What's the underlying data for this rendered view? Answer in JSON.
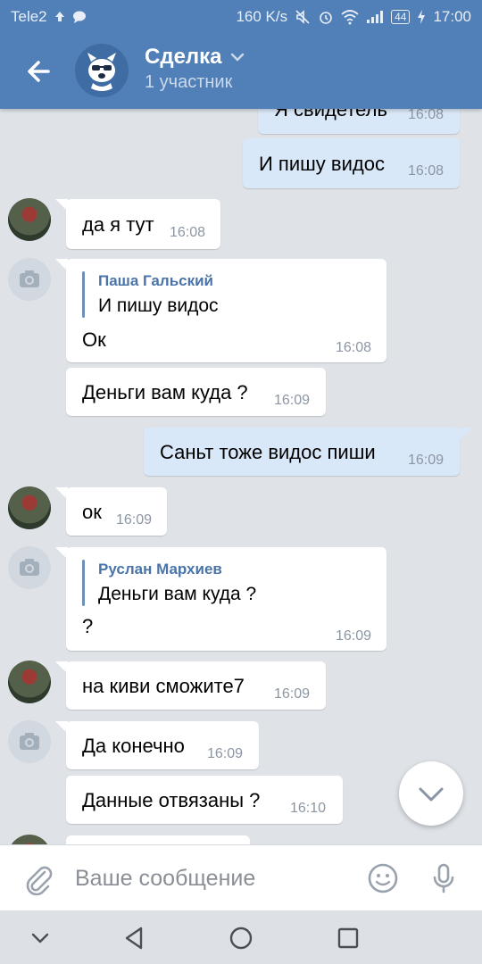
{
  "status_bar": {
    "carrier": "Tele2",
    "speed": "160 K/s",
    "battery": "44",
    "time": "17:00"
  },
  "header": {
    "title": "Сделка",
    "subtitle": "1 участник"
  },
  "messages": [
    {
      "direction": "out",
      "text": "Я свидетель",
      "time": "16:08"
    },
    {
      "direction": "out",
      "text": "И пишу видос",
      "time": "16:08"
    },
    {
      "direction": "in",
      "avatar": "user-photo",
      "text": "да я тут",
      "time": "16:08"
    },
    {
      "direction": "in",
      "avatar": "camera-placeholder",
      "quote_author": "Паша Гальский",
      "quote_text": "И пишу видос",
      "text": "Ок",
      "time": "16:08"
    },
    {
      "direction": "in",
      "text": "Деньги вам куда ?",
      "time": "16:09"
    },
    {
      "direction": "out",
      "text": "Саньт тоже видос пиши",
      "time": "16:09"
    },
    {
      "direction": "in",
      "avatar": "user-photo",
      "text": "ок",
      "time": "16:09"
    },
    {
      "direction": "in",
      "avatar": "camera-placeholder",
      "quote_author": "Руслан Мархиев",
      "quote_text": "Деньги вам куда ?",
      "text": "?",
      "time": "16:09"
    },
    {
      "direction": "in",
      "avatar": "user-photo",
      "text": "на киви сможите7",
      "time": "16:09"
    },
    {
      "direction": "in",
      "avatar": "camera-placeholder",
      "text": "Да конечно",
      "time": "16:09"
    },
    {
      "direction": "in",
      "text": "Данные отвязаны ?",
      "time": "16:10"
    }
  ],
  "composer": {
    "placeholder": "Ваше сообщение"
  },
  "icons": {
    "back": "arrow-left-icon",
    "dropdown": "chevron-down-icon",
    "attach": "paperclip-icon",
    "emoji": "smiley-icon",
    "mic": "microphone-icon",
    "scroll_down": "chevron-down-icon",
    "nav_down": "nav-down-icon",
    "nav_back": "nav-back-icon",
    "nav_home": "nav-home-icon",
    "nav_recent": "nav-recent-icon"
  },
  "colors": {
    "header": "#5180b8",
    "chat_background": "#dfe3e8",
    "outgoing_bubble": "#d9e8f8",
    "incoming_bubble": "#ffffff",
    "quote_accent": "#4a74a8"
  }
}
